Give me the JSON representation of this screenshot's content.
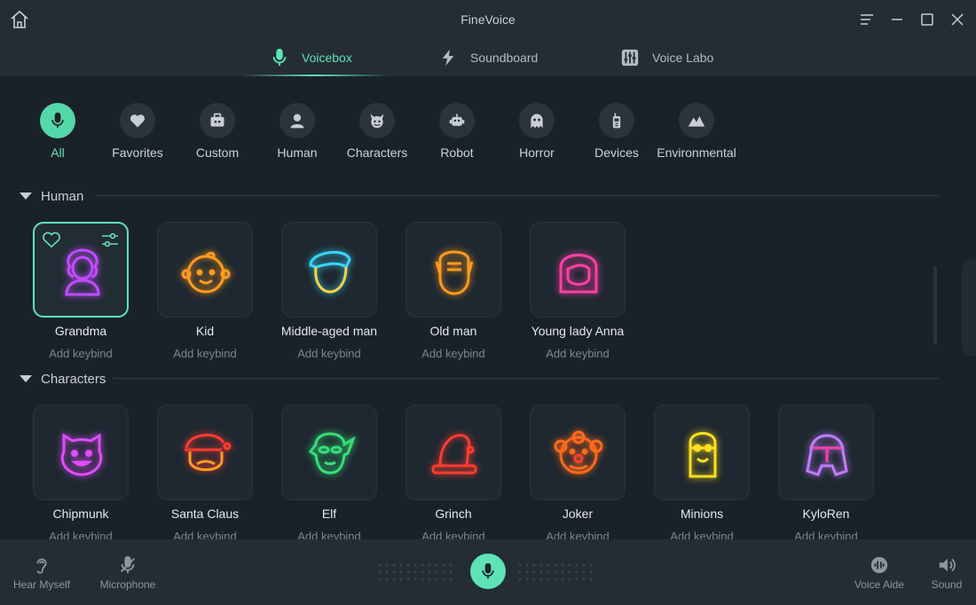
{
  "app": {
    "title": "FineVoice"
  },
  "tabs": [
    {
      "label": "Voicebox",
      "icon": "microphone-icon",
      "active": true
    },
    {
      "label": "Soundboard",
      "icon": "lightning-icon",
      "active": false
    },
    {
      "label": "Voice Labo",
      "icon": "sliders-icon",
      "active": false
    }
  ],
  "categories": [
    {
      "label": "All",
      "icon": "microphone-icon",
      "active": true
    },
    {
      "label": "Favorites",
      "icon": "heart-icon"
    },
    {
      "label": "Custom",
      "icon": "briefcase-icon"
    },
    {
      "label": "Human",
      "icon": "person-icon"
    },
    {
      "label": "Characters",
      "icon": "devil-icon"
    },
    {
      "label": "Robot",
      "icon": "robot-icon"
    },
    {
      "label": "Horror",
      "icon": "ghost-icon"
    },
    {
      "label": "Devices",
      "icon": "walkie-talkie-icon"
    },
    {
      "label": "Environmental",
      "icon": "mountain-icon"
    }
  ],
  "sections": {
    "human": {
      "title": "Human",
      "voices": [
        {
          "name": "Grandma",
          "keybind": "Add keybind",
          "selected": true,
          "color": "#c04cff"
        },
        {
          "name": "Kid",
          "keybind": "Add keybind",
          "color": "#ff9a1f"
        },
        {
          "name": "Middle-aged man",
          "keybind": "Add keybind",
          "color": "#38d6ff"
        },
        {
          "name": "Old man",
          "keybind": "Add keybind",
          "color": "#ff9a1f"
        },
        {
          "name": "Young lady Anna",
          "keybind": "Add keybind",
          "color": "#ff3fa8"
        }
      ]
    },
    "characters": {
      "title": "Characters",
      "voices": [
        {
          "name": "Chipmunk",
          "keybind": "Add keybind",
          "color": "#e04cff"
        },
        {
          "name": "Santa Claus",
          "keybind": "Add keybind",
          "color": "#ff3b30"
        },
        {
          "name": "Elf",
          "keybind": "Add keybind",
          "color": "#33e07a"
        },
        {
          "name": "Grinch",
          "keybind": "Add keybind",
          "color": "#ff3b30"
        },
        {
          "name": "Joker",
          "keybind": "Add keybind",
          "color": "#ff6a1a"
        },
        {
          "name": "Minions",
          "keybind": "Add keybind",
          "color": "#ffe01a"
        },
        {
          "name": "KyloRen",
          "keybind": "Add keybind",
          "color": "#c07cff"
        }
      ]
    }
  },
  "bottom": {
    "hear_myself": "Hear Myself",
    "microphone": "Microphone",
    "voice_aide": "Voice Aide",
    "sound": "Sound"
  },
  "colors": {
    "accent": "#5fe3b6",
    "background": "#1a2229",
    "bar": "#242d35"
  }
}
